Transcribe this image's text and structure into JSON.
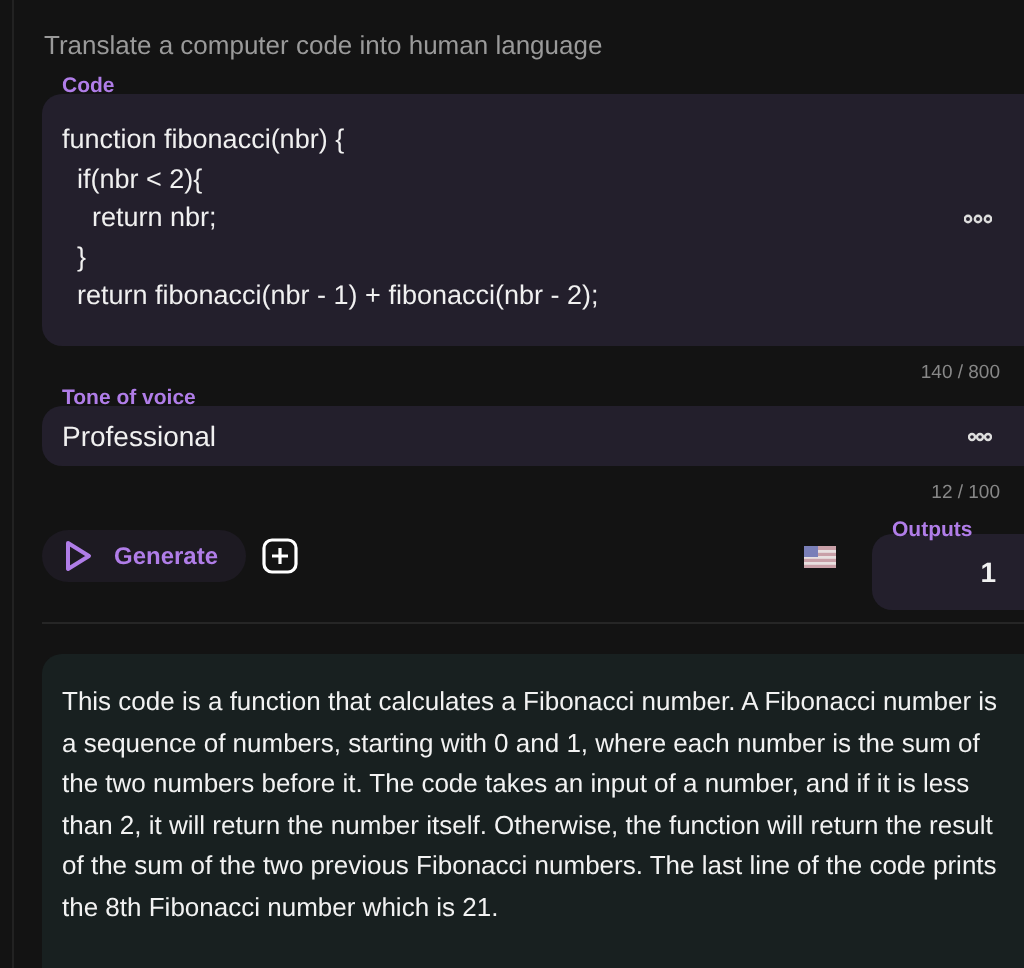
{
  "heading": "Translate a computer code into human language",
  "code_field": {
    "label": "Code",
    "lines": [
      "function fibonacci(nbr) {",
      "  if(nbr < 2){",
      "    return nbr;",
      "  }",
      "  return fibonacci(nbr - 1) + fibonacci(nbr - 2);"
    ],
    "counter": "140 / 800"
  },
  "tone_field": {
    "label": "Tone of voice",
    "value": "Professional",
    "counter": "12 / 100"
  },
  "generate_button": {
    "label": "Generate"
  },
  "outputs": {
    "label": "Outputs",
    "value": "1"
  },
  "result": "This code is a function that calculates a Fibonacci number. A Fibonacci number is a sequence of numbers, starting with 0 and 1, where each number is the sum of the two numbers before it. The code takes an input of a number, and if it is less than 2, it will return the number itself. Otherwise, the function will return the result of the sum of the two previous Fibonacci numbers. The last line of the code prints the 8th Fibonacci number which is 21."
}
